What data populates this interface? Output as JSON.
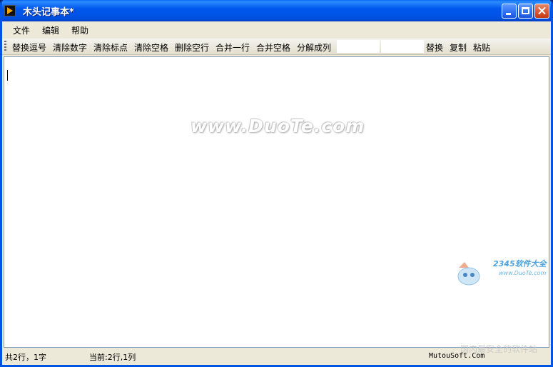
{
  "window": {
    "title": "木头记事本*",
    "controls": [
      "minimize",
      "maximize",
      "close"
    ]
  },
  "menu": {
    "items": [
      "文件",
      "编辑",
      "帮助"
    ]
  },
  "toolbar": {
    "buttons_left": [
      "替换逗号",
      "清除数字",
      "清除标点",
      "清除空格",
      "删除空行",
      "合并一行",
      "合并空格",
      "分解成列"
    ],
    "find_value": "",
    "replace_value": "",
    "buttons_right": [
      "替换",
      "复制",
      "粘贴"
    ]
  },
  "editor": {
    "content": ""
  },
  "watermark": {
    "text": "www.DuoTe.com"
  },
  "corner_logo": {
    "title": "2345软件大全",
    "url": "www.DuoTe.com",
    "slogan": "国内最安全的软件站"
  },
  "status": {
    "totals": "共2行，1字",
    "cursor": "当前:2行,1列",
    "site": "MutouSoft.Com"
  },
  "colors": {
    "titlebar": "#0054e3",
    "chrome": "#ece9d8",
    "editor_bg": "#ffffff"
  }
}
